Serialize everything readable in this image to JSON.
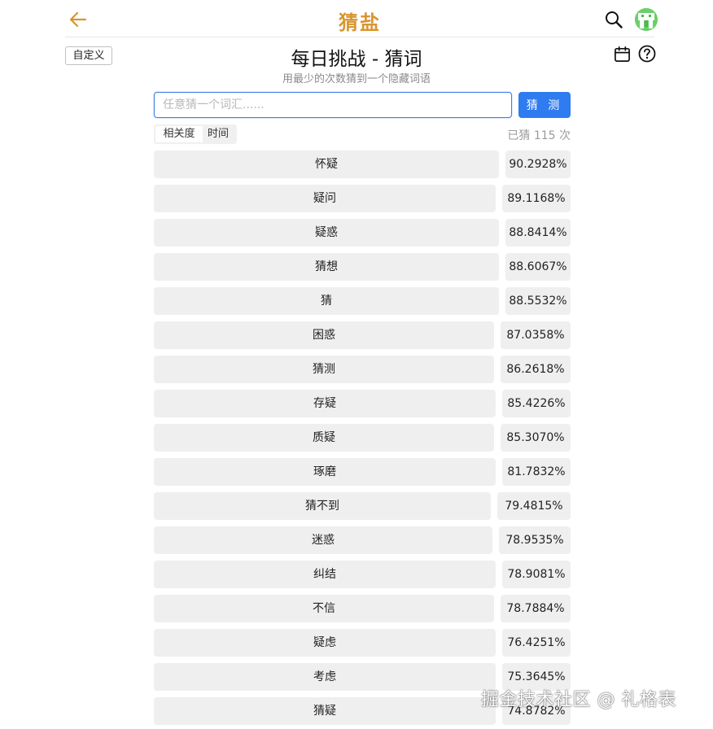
{
  "header": {
    "title": "猜盐",
    "accent_color": "#d9952e",
    "back_icon": "arrow-left-icon",
    "search_icon": "search-icon",
    "avatar_icon": "avatar-icon"
  },
  "subheader": {
    "custom_label": "自定义",
    "title": "每日挑战 - 猜词",
    "subtitle": "用最少的次数猜到一个隐藏词语",
    "calendar_icon": "calendar-icon",
    "help_icon": "help-icon"
  },
  "input": {
    "placeholder": "任意猜一个词汇......",
    "value": "",
    "button_label": "猜 测",
    "button_color": "#2f7bf0"
  },
  "sort": {
    "options": [
      "相关度",
      "时间"
    ],
    "selected": "相关度"
  },
  "guess_count_text": "已猜 115 次",
  "guesses": [
    {
      "word": "怀疑",
      "score": "90.2928%"
    },
    {
      "word": "疑问",
      "score": "89.1168%"
    },
    {
      "word": "疑惑",
      "score": "88.8414%"
    },
    {
      "word": "猜想",
      "score": "88.6067%"
    },
    {
      "word": "猜",
      "score": "88.5532%"
    },
    {
      "word": "困惑",
      "score": "87.0358%"
    },
    {
      "word": "猜测",
      "score": "86.2618%"
    },
    {
      "word": "存疑",
      "score": "85.4226%"
    },
    {
      "word": "质疑",
      "score": "85.3070%"
    },
    {
      "word": "琢磨",
      "score": "81.7832%"
    },
    {
      "word": "猜不到",
      "score": "79.4815%"
    },
    {
      "word": "迷惑",
      "score": "78.9535%"
    },
    {
      "word": "纠结",
      "score": "78.9081%"
    },
    {
      "word": "不信",
      "score": "78.7884%"
    },
    {
      "word": "疑虑",
      "score": "76.4251%"
    },
    {
      "word": "考虑",
      "score": "75.3645%"
    },
    {
      "word": "猜疑",
      "score": "74.8782%"
    }
  ],
  "watermark": "掘金技术社区 @ 礼格表"
}
